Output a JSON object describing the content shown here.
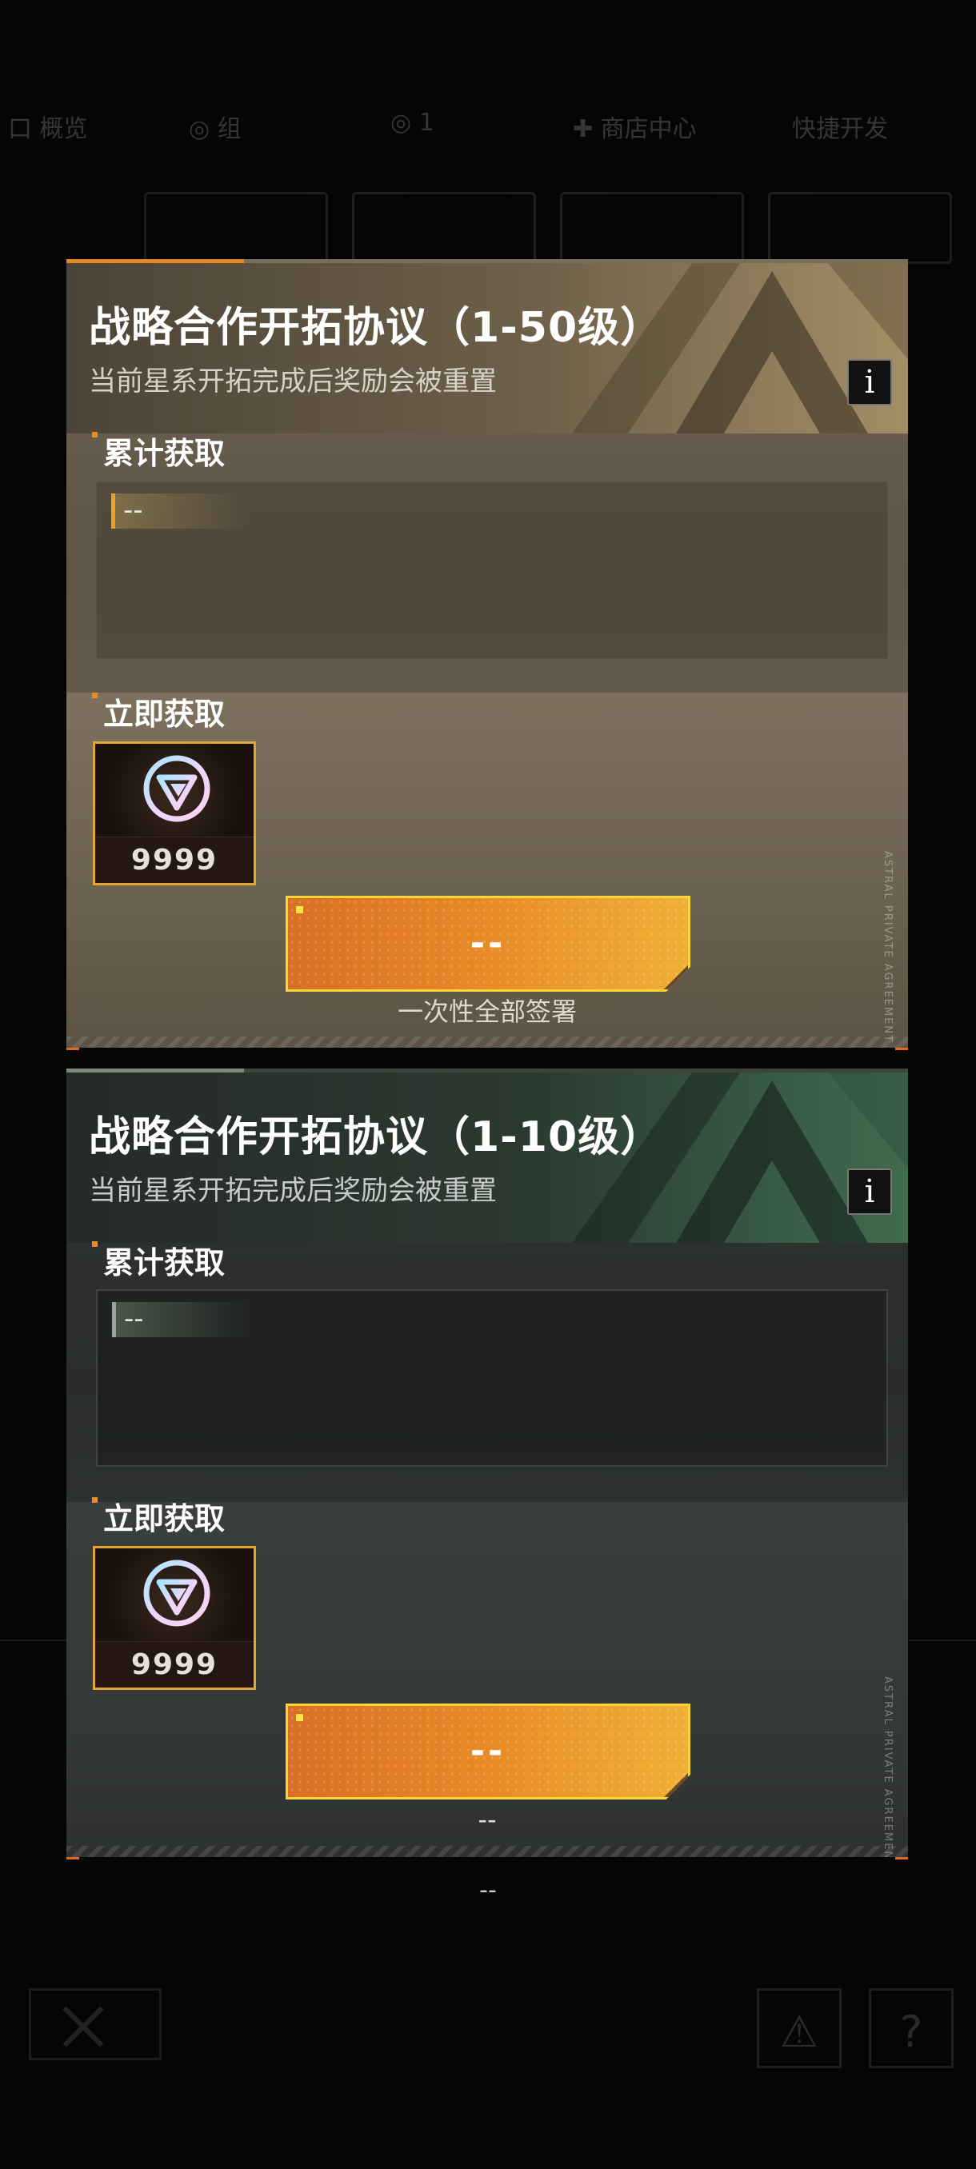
{
  "background": {
    "top_tabs": [
      "口 概览",
      "◎ 组",
      "◎ 1",
      "✚ 商店中心",
      "快捷开发"
    ],
    "close_label": "✕",
    "warning_label": "⚠",
    "help_label": "?"
  },
  "panels": [
    {
      "title": "战略合作开拓协议（1-50级）",
      "subtitle": "当前星系开拓完成后奖励会被重置",
      "info_label": "i",
      "accumulated_label": "累计获取",
      "accumulated_value": "--",
      "instant_label": "立即获取",
      "reward_count": "9999",
      "reward_icon": "triangle-emblem-icon",
      "button_label": "--",
      "button_note": "一次性全部签署",
      "theme_color": "#e58a1f",
      "watermark": "ASTRAL PRIVATE AGREEMENT"
    },
    {
      "title": "战略合作开拓协议（1-10级）",
      "subtitle": "当前星系开拓完成后奖励会被重置",
      "info_label": "i",
      "accumulated_label": "累计获取",
      "accumulated_value": "--",
      "instant_label": "立即获取",
      "reward_count": "9999",
      "reward_icon": "triangle-emblem-icon",
      "button_label": "--",
      "button_note": "--",
      "theme_color": "#3f6b4e",
      "watermark": "ASTRAL PRIVATE AGREEMENT"
    }
  ],
  "footer": {
    "text": "--"
  }
}
